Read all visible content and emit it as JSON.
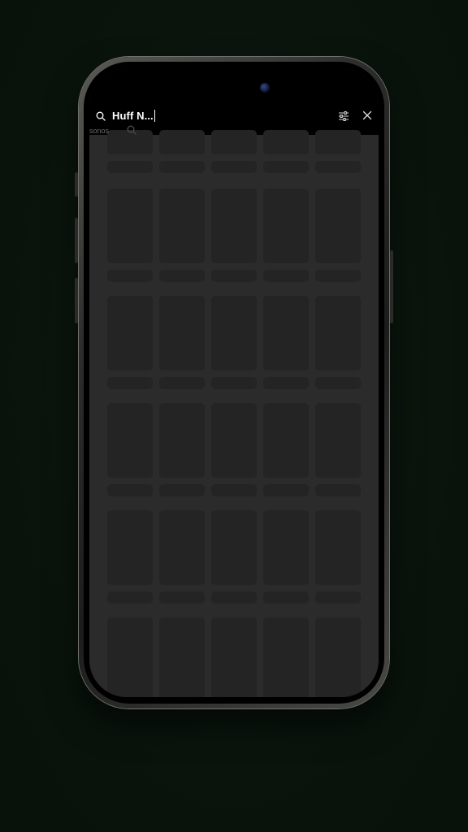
{
  "search": {
    "query": "Huff N...",
    "ghost_label": "sonos"
  },
  "icons": {
    "search": "search-icon",
    "filter": "sliders-icon",
    "close": "close-icon"
  },
  "colors": {
    "background": "#0b150d",
    "screen": "#262626",
    "placeholder": "#242424",
    "text": "#ffffff"
  }
}
